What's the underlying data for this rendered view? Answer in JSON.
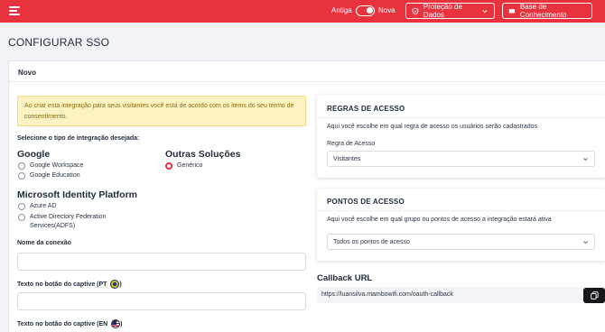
{
  "header": {
    "toggle_left": "Antiga",
    "toggle_right": "Nova",
    "protecao_label": "Proteção de Dados",
    "base_label": "Base de Conhecimento"
  },
  "page": {
    "title": "CONFIGURAR SSO"
  },
  "card": {
    "title": "Novo"
  },
  "notice": {
    "text": "Ao criar esta integração para seus visitantes você está de acordo com os items do seu termo de consentimento."
  },
  "integration": {
    "prompt": "Selecione o tipo de integração desejada:",
    "google": {
      "title": "Google",
      "options": [
        "Google Workspace",
        "Google Education"
      ]
    },
    "outras": {
      "title": "Outras Soluções",
      "options": [
        "Genérico"
      ],
      "selected": "Genérico"
    },
    "microsoft": {
      "title": "Microsoft Identity Platform",
      "options": [
        "Azure AD",
        "Active Directory Federation Services(ADFS)"
      ]
    }
  },
  "fields": {
    "connection_name_label": "Nome da conexão",
    "captive_pt_label": "Texto no botão do captive (PT",
    "captive_en_label": "Texto no botão do captive (EN",
    "close_paren": ")"
  },
  "regras": {
    "title": "REGRAS DE ACESSO",
    "description": "Aqui você escolhe em qual regra de acesso os usuários serão cadastrados",
    "select_label": "Regra de Acesso",
    "select_value": "Visitantes"
  },
  "pontos": {
    "title": "PONTOS DE ACESSO",
    "description": "Aqui você escolhe em qual grupo ou pontos de acesso a integração estará ativa",
    "select_value": "Todos os pontos de acesso"
  },
  "callback": {
    "title": "Callback URL",
    "url": "https://luansilva.mambowifi.com/oauth-callback"
  },
  "colors": {
    "brand": "#e8323e",
    "notice_bg": "#fdf3c2"
  },
  "icons": [
    "menu-icon",
    "shield-icon",
    "book-icon",
    "chevron-down-icon",
    "copy-icon",
    "brazil-flag-icon",
    "us-flag-icon"
  ]
}
